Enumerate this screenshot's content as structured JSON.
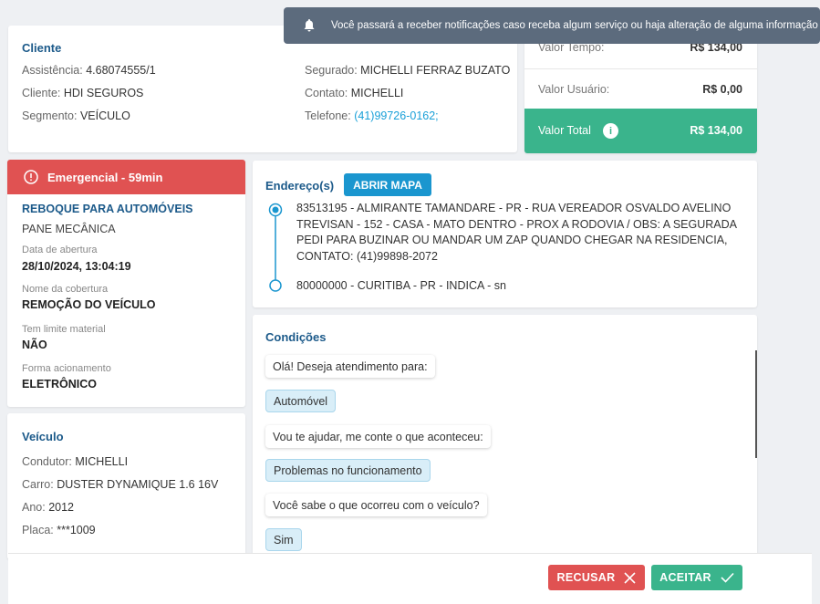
{
  "notification": {
    "text": "Você passará a receber notificações caso receba algum serviço ou haja alteração de alguma informação",
    "icon": "bell-icon"
  },
  "client": {
    "title": "Cliente",
    "assistencia_label": "Assistência:",
    "assistencia_value": "4.68074555/1",
    "cliente_label": "Cliente:",
    "cliente_value": "HDI SEGUROS",
    "segmento_label": "Segmento:",
    "segmento_value": "VEÍCULO",
    "segurado_label": "Segurado:",
    "segurado_value": "MICHELLI FERRAZ BUZATO",
    "contato_label": "Contato:",
    "contato_value": "MICHELLI",
    "telefone_label": "Telefone:",
    "telefone_value": "(41)99726-0162;"
  },
  "values": {
    "tempo_label": "Valor Tempo:",
    "tempo_value": "R$ 134,00",
    "usuario_label": "Valor Usuário:",
    "usuario_value": "R$ 0,00",
    "total_label": "Valor Total",
    "total_value": "R$ 134,00"
  },
  "service": {
    "header": "Emergencial - 59min",
    "type": "REBOQUE PARA AUTOMÓVEIS",
    "problem": "PANE MECÂNICA",
    "abertura_label": "Data de abertura",
    "abertura_value": "28/10/2024, 13:04:19",
    "cobertura_label": "Nome da cobertura",
    "cobertura_value": "REMOÇÃO DO VEÍCULO",
    "limite_label": "Tem limite material",
    "limite_value": "NÃO",
    "forma_label": "Forma acionamento",
    "forma_value": "ELETRÔNICO"
  },
  "vehicle": {
    "title": "Veículo",
    "condutor_label": "Condutor:",
    "condutor_value": "MICHELLI",
    "carro_label": "Carro:",
    "carro_value": "DUSTER DYNAMIQUE 1.6 16V",
    "ano_label": "Ano:",
    "ano_value": "2012",
    "placa_label": "Placa:",
    "placa_value": "***1009"
  },
  "address": {
    "title": "Endereço(s)",
    "map_button": "ABRIR MAPA",
    "origin": "83513195 - ALMIRANTE TAMANDARE - PR - RUA VEREADOR OSVALDO AVELINO TREVISAN - 152 - CASA - MATO DENTRO - PROX A RODOVIA / OBS: A SEGURADA PEDI PARA BUZINAR OU MANDAR UM ZAP QUANDO CHEGAR NA RESIDENCIA, CONTATO: (41)99898-2072",
    "destination": "80000000 - CURITIBA - PR - INDICA - sn"
  },
  "conditions": {
    "title": "Condições",
    "messages": [
      {
        "text": "Olá! Deseja atendimento para:",
        "from": "bot"
      },
      {
        "text": "Automóvel",
        "from": "user"
      },
      {
        "text": "Vou te ajudar, me conte o que aconteceu:",
        "from": "bot"
      },
      {
        "text": "Problemas no funcionamento",
        "from": "user"
      },
      {
        "text": "Você sabe o que ocorreu com o veículo?",
        "from": "bot"
      },
      {
        "text": "Sim",
        "from": "user"
      }
    ]
  },
  "actions": {
    "refuse": "RECUSAR",
    "accept": "ACEITAR"
  },
  "colors": {
    "accent_blue": "#1a96cf",
    "danger": "#e05252",
    "success": "#3ab48c",
    "toast": "#5c6b7d"
  }
}
